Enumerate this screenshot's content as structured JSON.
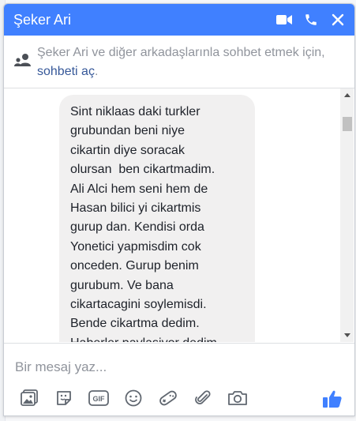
{
  "header": {
    "title": "Şeker Ari",
    "icons": [
      "video-camera-icon",
      "phone-icon",
      "close-icon"
    ],
    "color": "#4080ff"
  },
  "notice": {
    "text_before": "Şeker Ari ve diğer arkadaşlarınla sohbet etmek için, ",
    "link": "sohbeti aç",
    "text_after": "."
  },
  "message": {
    "lines": [
      "Sint niklaas daki turkler",
      "grubundan beni niye",
      "cikartin diye soracak",
      "olursan  ben cikartmadim.",
      "Ali Alci hem seni hem de",
      "Hasan bilici yi cikartmis",
      "gurup dan. Kendisi orda",
      "Yonetici yapmisdim cok",
      "onceden. Gurup benim",
      "gurubum. Ve bana",
      "cikartacagini soylemisdi.",
      "Bende cikartma dedim.",
      "Haberler paylasiyor dedim."
    ]
  },
  "composer": {
    "placeholder": "Bir mesaj yaz...",
    "tools": [
      "photo-icon",
      "sticker-icon",
      "gif-icon",
      "emoji-icon",
      "game-controller-icon",
      "attachment-icon",
      "camera-icon"
    ],
    "like_icon": "thumbs-up-icon",
    "accent": "#4080ff"
  }
}
